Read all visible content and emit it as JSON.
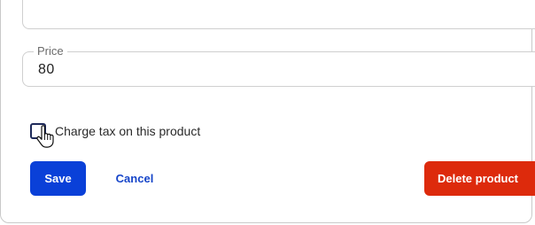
{
  "form": {
    "price": {
      "label": "Price",
      "value": "80"
    },
    "charge_tax": {
      "label": "Charge tax on this product",
      "checked": false
    }
  },
  "actions": {
    "save_label": "Save",
    "cancel_label": "Cancel",
    "delete_label": "Delete product"
  },
  "colors": {
    "primary": "#0a40d8",
    "danger": "#dd2a0c",
    "link": "#1645c9",
    "checkbox_border": "#1e2a5a"
  },
  "icons": {
    "cursor": "hand-pointer-icon"
  }
}
